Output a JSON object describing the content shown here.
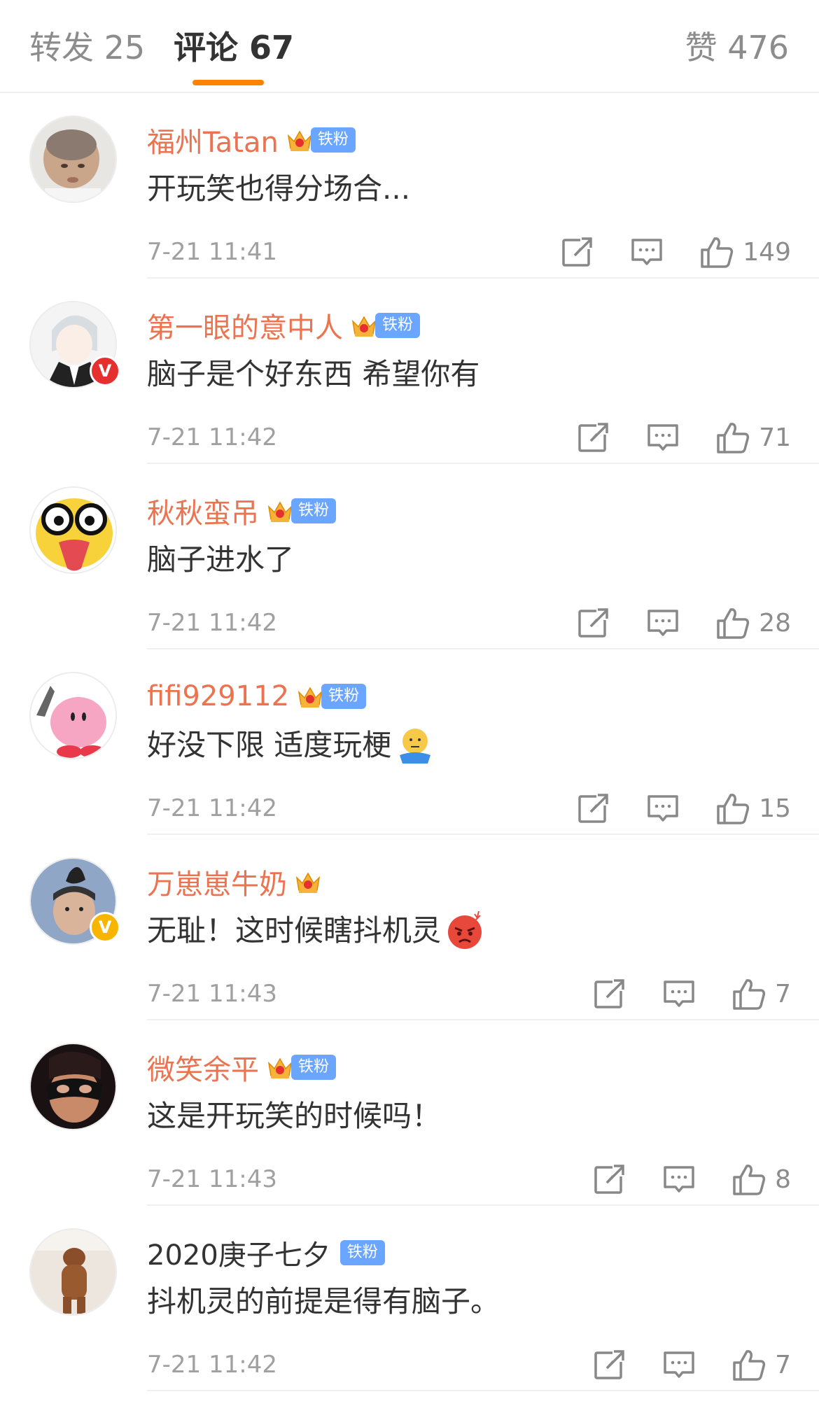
{
  "tabs": {
    "repost": "转发 25",
    "comments": "评论 67",
    "likes": "赞 476"
  },
  "colors": {
    "accent": "#ff8200",
    "username": "#eb7350",
    "fan_badge": "#6aa5ff",
    "muted": "#a0a0a0"
  },
  "comments": [
    {
      "username": "福州Tatan",
      "badge": "铁粉",
      "text": "开玩笑也得分场合...",
      "time": "7-21 11:41",
      "likes": "149",
      "avatar": "baby-avatar",
      "crown_level": "3"
    },
    {
      "username": "第一眼的意中人",
      "badge": "铁粉",
      "text": "脑子是个好东西 希望你有",
      "time": "7-21 11:42",
      "likes": "71",
      "avatar": "anime-avatar",
      "verified": "red",
      "crown_level": "7"
    },
    {
      "username": "秋秋蛮吊",
      "badge": "铁粉",
      "text": "脑子进水了",
      "time": "7-21 11:42",
      "likes": "28",
      "avatar": "goofy-face-avatar",
      "crown_level": "5"
    },
    {
      "username": "fifi929112",
      "badge": "铁粉",
      "text": "好没下限 适度玩梗",
      "time": "7-21 11:42",
      "likes": "15",
      "avatar": "kirby-knife-avatar",
      "crown_level": "3",
      "emoji": "shrug-emoji"
    },
    {
      "username": "万崽崽牛奶",
      "text": "无耻！这时候瞎抖机灵",
      "time": "7-21 11:43",
      "likes": "7",
      "avatar": "kid-avatar",
      "verified": "gold",
      "crown_level": "4",
      "emoji": "angry-emoji"
    },
    {
      "username": "微笑余平",
      "badge": "铁粉",
      "text": "这是开玩笑的时候吗！",
      "time": "7-21 11:43",
      "likes": "8",
      "avatar": "masked-avatar",
      "crown_level": "3"
    },
    {
      "username": "2020庚子七夕",
      "badge": "铁粉",
      "text": "抖机灵的前提是得有脑子。",
      "time": "7-21 11:42",
      "likes": "7",
      "avatar": "bear-avatar"
    }
  ]
}
